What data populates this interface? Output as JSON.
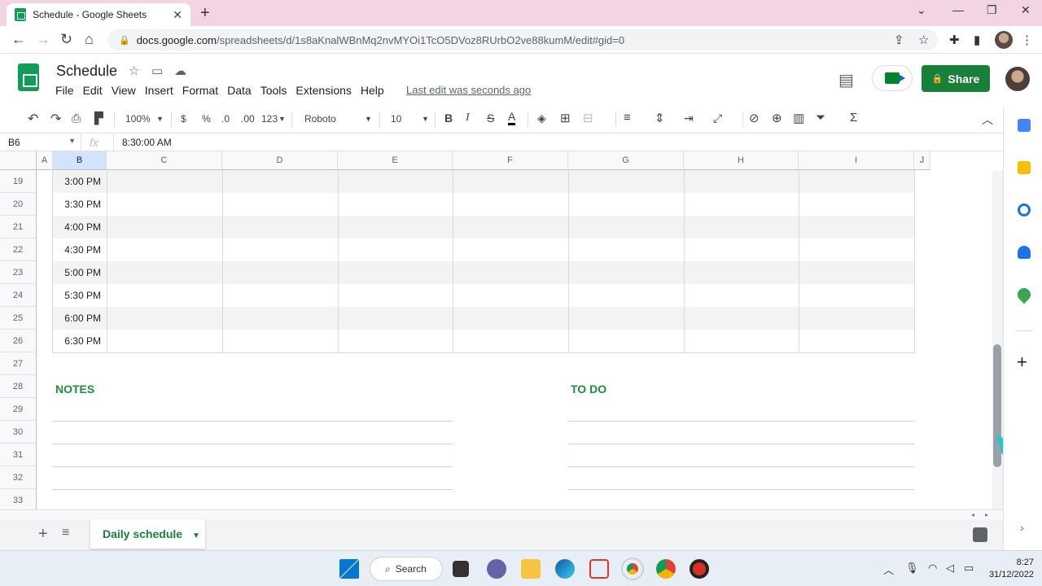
{
  "browser": {
    "tab_title": "Schedule - Google Sheets",
    "tab_close": "✕",
    "new_tab": "+",
    "url_host": "docs.google.com",
    "url_path": "/spreadsheets/d/1s8aKnalWBnMq2nvMYOi1TcO5DVoz8RUrbO2ve88kumM/edit#gid=0"
  },
  "sheets": {
    "title": "Schedule",
    "menu": [
      "File",
      "Edit",
      "View",
      "Insert",
      "Format",
      "Data",
      "Tools",
      "Extensions",
      "Help"
    ],
    "last_edit": "Last edit was seconds ago",
    "share_label": "Share"
  },
  "toolbar": {
    "zoom": "100%",
    "currency": "$",
    "percent": "%",
    "dec_decrease": ".0",
    "dec_increase": ".00",
    "more_formats": "123",
    "font": "Roboto",
    "font_size": "10",
    "bold": "B",
    "italic": "I",
    "strike": "S",
    "text_color": "A"
  },
  "formula_bar": {
    "cell_ref": "B6",
    "fx": "fx",
    "value": "8:30:00 AM"
  },
  "grid": {
    "columns": [
      "A",
      "B",
      "C",
      "D",
      "E",
      "F",
      "G",
      "H",
      "I",
      "J"
    ],
    "rows": [
      {
        "num": "19",
        "time": "3:00 PM"
      },
      {
        "num": "20",
        "time": "3:30 PM"
      },
      {
        "num": "21",
        "time": "4:00 PM"
      },
      {
        "num": "22",
        "time": "4:30 PM"
      },
      {
        "num": "23",
        "time": "5:00 PM"
      },
      {
        "num": "24",
        "time": "5:30 PM"
      },
      {
        "num": "25",
        "time": "6:00 PM"
      },
      {
        "num": "26",
        "time": "6:30 PM"
      },
      {
        "num": "27",
        "time": ""
      },
      {
        "num": "28",
        "time": ""
      },
      {
        "num": "29",
        "time": ""
      },
      {
        "num": "30",
        "time": ""
      },
      {
        "num": "31",
        "time": ""
      },
      {
        "num": "32",
        "time": ""
      },
      {
        "num": "33",
        "time": ""
      }
    ],
    "notes_title": "NOTES",
    "todo_title": "TO DO"
  },
  "sheet_tabs": {
    "add": "+",
    "active": "Daily schedule"
  },
  "taskbar": {
    "search_label": "Search",
    "time": "8:27",
    "date": "31/12/2022"
  },
  "colors": {
    "sheets_green": "#188038",
    "section_green": "#1e8e3e",
    "selected_header": "#d3e3fd",
    "row_shade": "#f3f3f3"
  }
}
